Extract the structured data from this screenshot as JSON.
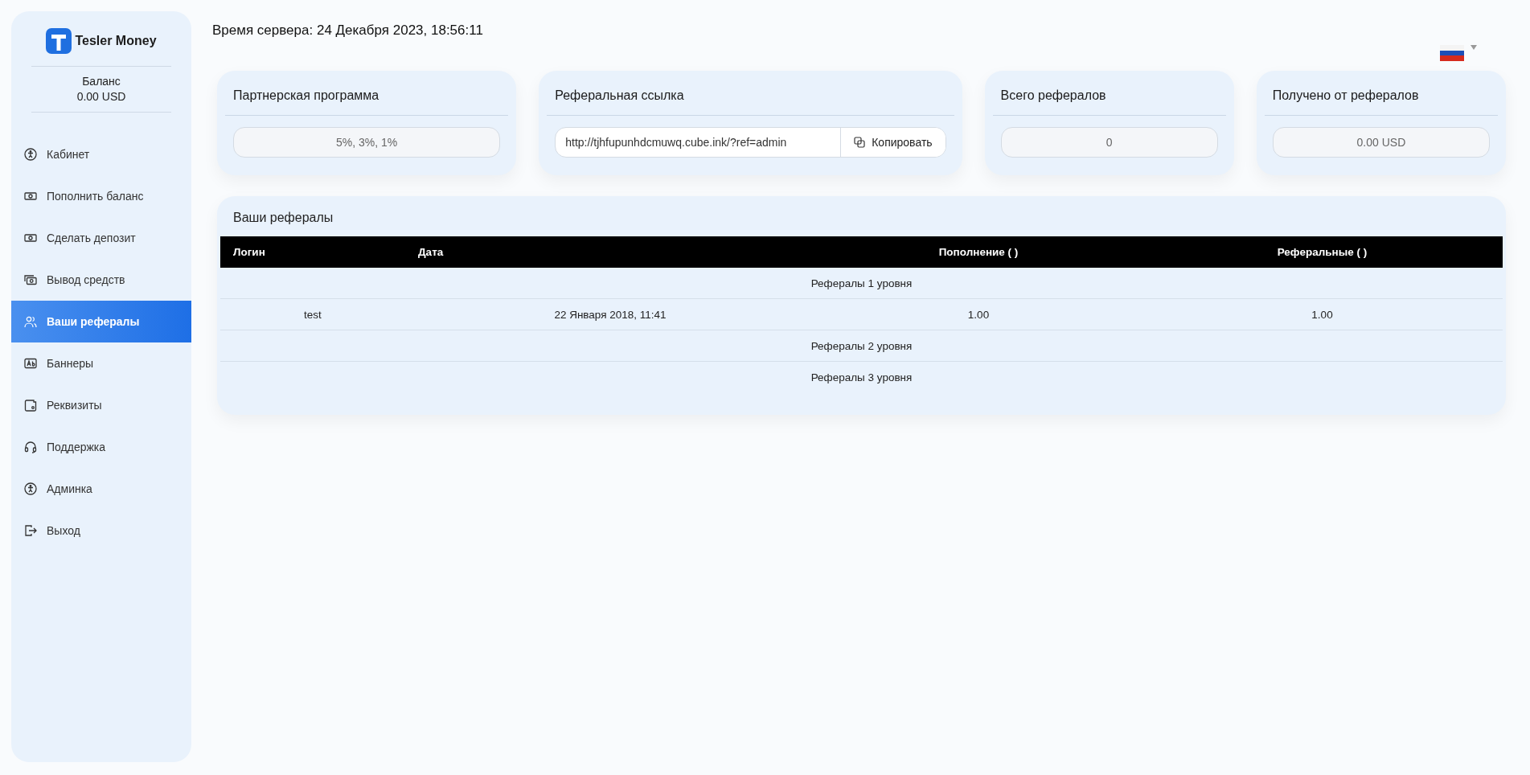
{
  "logo": {
    "text": "Tesler Money"
  },
  "balance": {
    "label": "Баланс",
    "value": "0.00 USD"
  },
  "nav": [
    {
      "label": "Кабинет",
      "selected": false
    },
    {
      "label": "Пополнить баланс",
      "selected": false
    },
    {
      "label": "Сделать депозит",
      "selected": false
    },
    {
      "label": "Вывод средств",
      "selected": false
    },
    {
      "label": "Ваши рефералы",
      "selected": true
    },
    {
      "label": "Баннеры",
      "selected": false
    },
    {
      "label": "Реквизиты",
      "selected": false
    },
    {
      "label": "Поддержка",
      "selected": false
    },
    {
      "label": "Админка",
      "selected": false
    },
    {
      "label": "Выход",
      "selected": false
    }
  ],
  "server_time": "Время сервера: 24 Декабря 2023, 18:56:11",
  "cards": [
    {
      "kind": "value",
      "title": "Партнерская программа",
      "value": "5%, 3%, 1%"
    },
    {
      "kind": "link",
      "title": "Реферальная ссылка",
      "value": "http://tjhfupunhdcmuwq.cube.ink/?ref=admin",
      "button": "Копировать"
    },
    {
      "kind": "value",
      "title": "Всего рефералов",
      "value": "0"
    },
    {
      "kind": "value",
      "title": "Получено от рефералов",
      "value": "0.00 USD"
    }
  ],
  "referrals": {
    "title": "Ваши рефералы",
    "columns": [
      "Логин",
      "Дата",
      "Пополнение ( )",
      "Реферальные ( )"
    ],
    "rows": [
      {
        "kind": "group",
        "label": "Рефералы 1 уровня"
      },
      {
        "kind": "row",
        "cells": [
          "test",
          "22 Января 2018, 11:41",
          "1.00",
          "1.00"
        ]
      },
      {
        "kind": "group",
        "label": "Рефералы 2 уровня"
      },
      {
        "kind": "group",
        "label": "Рефералы 3 уровня"
      }
    ]
  }
}
